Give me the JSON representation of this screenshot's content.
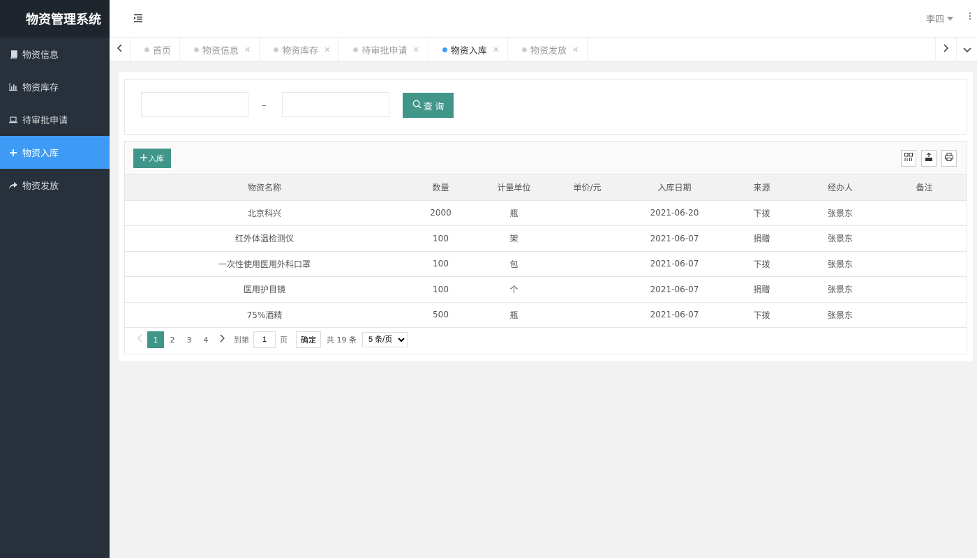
{
  "app": {
    "title": "物资管理系统"
  },
  "sidebar": {
    "items": [
      {
        "label": "物资信息",
        "icon": "book-icon"
      },
      {
        "label": "物资库存",
        "icon": "bar-chart-icon"
      },
      {
        "label": "待审批申请",
        "icon": "laptop-icon"
      },
      {
        "label": "物资入库",
        "icon": "plus-icon",
        "active": true
      },
      {
        "label": "物资发放",
        "icon": "share-arrow-icon"
      }
    ]
  },
  "header": {
    "user": "李四"
  },
  "tabs": [
    {
      "label": "首页",
      "closable": false
    },
    {
      "label": "物资信息",
      "closable": true
    },
    {
      "label": "物资库存",
      "closable": true
    },
    {
      "label": "待审批申请",
      "closable": true
    },
    {
      "label": "物资入库",
      "closable": true,
      "active": true
    },
    {
      "label": "物资发放",
      "closable": true
    }
  ],
  "search": {
    "start_value": "",
    "end_value": "",
    "separator": "–",
    "query_label": "查 询"
  },
  "toolbar": {
    "add_label": "入库"
  },
  "table": {
    "columns": [
      "物资名称",
      "数量",
      "计量单位",
      "单价/元",
      "入库日期",
      "来源",
      "经办人",
      "备注"
    ],
    "rows": [
      [
        "北京科兴",
        "2000",
        "瓶",
        "",
        "2021-06-20",
        "下拨",
        "张景东",
        ""
      ],
      [
        "红外体温检测仪",
        "100",
        "架",
        "",
        "2021-06-07",
        "捐赠",
        "张景东",
        ""
      ],
      [
        "一次性使用医用外科口罩",
        "100",
        "包",
        "",
        "2021-06-07",
        "下拨",
        "张景东",
        ""
      ],
      [
        "医用护目镜",
        "100",
        "个",
        "",
        "2021-06-07",
        "捐赠",
        "张景东",
        ""
      ],
      [
        "75%酒精",
        "500",
        "瓶",
        "",
        "2021-06-07",
        "下拨",
        "张景东",
        ""
      ]
    ]
  },
  "pagination": {
    "pages": [
      "1",
      "2",
      "3",
      "4"
    ],
    "current": "1",
    "goto_prefix": "到第",
    "goto_value": "1",
    "goto_suffix": "页",
    "confirm_label": "确定",
    "total_text": "共 19 条",
    "page_size": "5 条/页"
  },
  "colors": {
    "accent": "#409688",
    "sidebar_bg": "#28313b",
    "active_nav": "#3d9bf5"
  }
}
